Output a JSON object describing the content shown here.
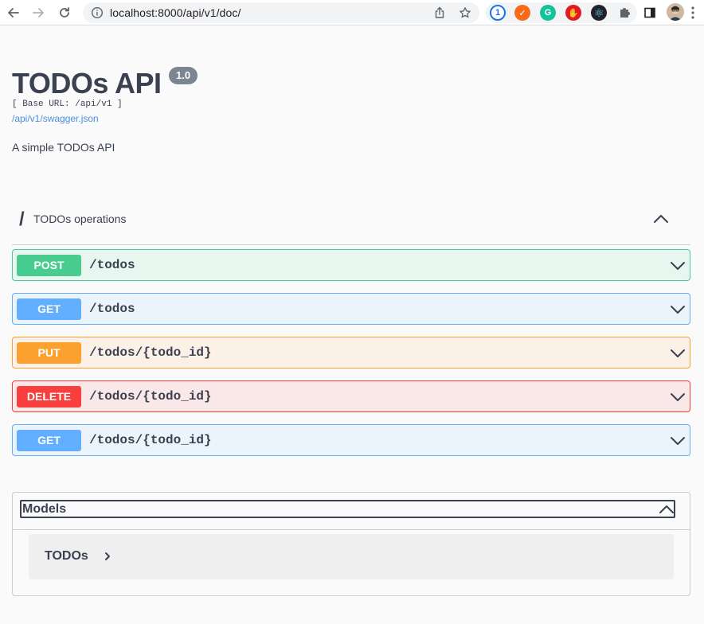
{
  "browser": {
    "url": "localhost:8000/api/v1/doc/",
    "extensions": [
      {
        "name": "onepassword-icon",
        "color": "#1a73e8",
        "glyph": "1"
      },
      {
        "name": "orange-extension-icon",
        "color": "#f96a1a",
        "glyph": "✓"
      },
      {
        "name": "grammarly-icon",
        "color": "#15c39a",
        "glyph": "G"
      },
      {
        "name": "ublock-icon",
        "color": "#e01b24",
        "glyph": "✋"
      },
      {
        "name": "react-devtools-icon",
        "color": "#20232a",
        "glyph": "⚛"
      }
    ]
  },
  "info": {
    "title": "TODOs API",
    "version": "1.0",
    "base_url": "[ Base URL: /api/v1 ]",
    "spec_link": "/api/v1/swagger.json",
    "description": "A simple TODOs API"
  },
  "tag": {
    "slash": "/",
    "name": "TODOs operations"
  },
  "operations": [
    {
      "method": "POST",
      "path": "/todos"
    },
    {
      "method": "GET",
      "path": "/todos"
    },
    {
      "method": "PUT",
      "path": "/todos/{todo_id}"
    },
    {
      "method": "DELETE",
      "path": "/todos/{todo_id}"
    },
    {
      "method": "GET",
      "path": "/todos/{todo_id}"
    }
  ],
  "models": {
    "title": "Models",
    "items": [
      {
        "name": "TODOs"
      }
    ]
  }
}
